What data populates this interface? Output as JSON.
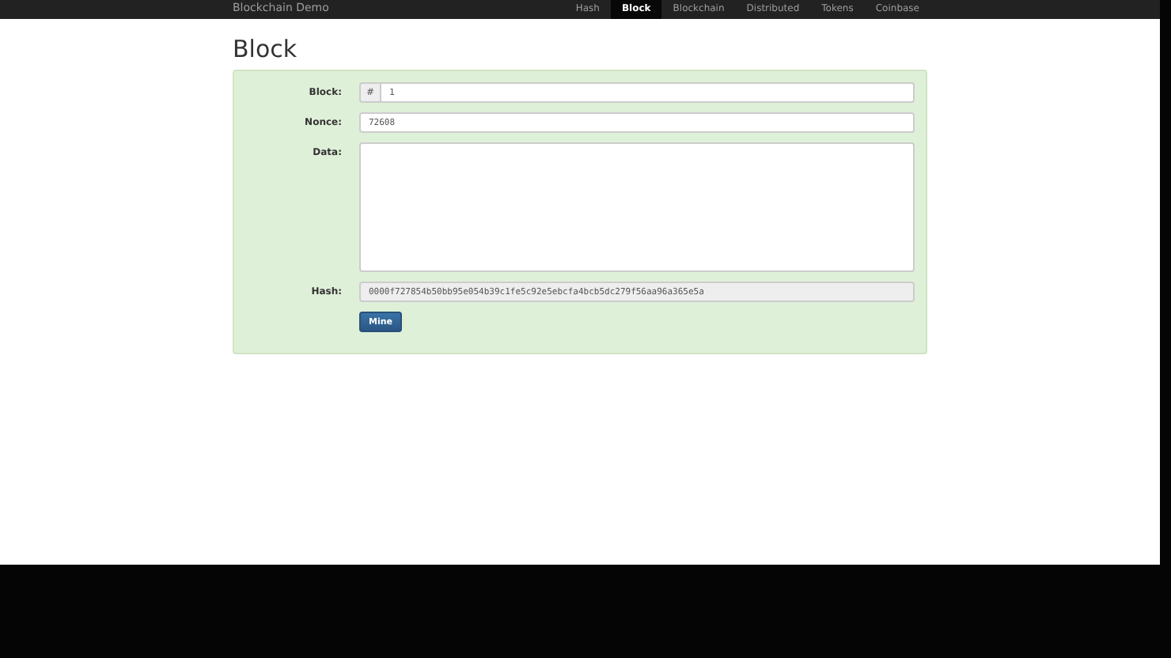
{
  "navbar": {
    "brand": "Blockchain Demo",
    "links": [
      {
        "label": "Hash",
        "selected": false
      },
      {
        "label": "Block",
        "selected": true
      },
      {
        "label": "Blockchain",
        "selected": false
      },
      {
        "label": "Distributed",
        "selected": false
      },
      {
        "label": "Tokens",
        "selected": false
      },
      {
        "label": "Coinbase",
        "selected": false
      }
    ]
  },
  "title": "Block",
  "form": {
    "block_label": "Block:",
    "block_addon": "#",
    "block_value": "1",
    "nonce_label": "Nonce:",
    "nonce_value": "72608",
    "data_label": "Data:",
    "hash_label": "Hash:",
    "hash_value": "0000f727854b50bb95e054b39c1fe5c92e5ebcfa4bcb5dc279f56aa96a365e5a",
    "mine_button": "Mine"
  }
}
